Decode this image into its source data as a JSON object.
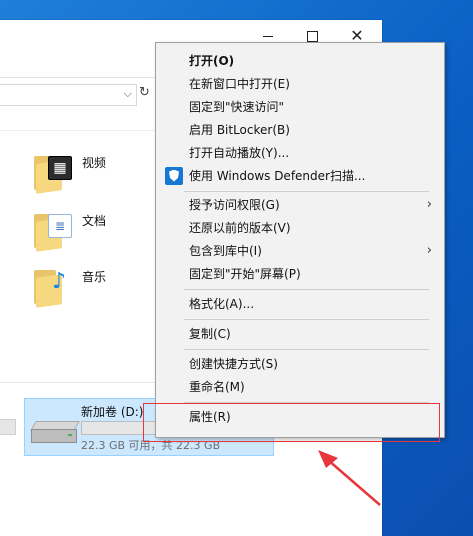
{
  "window": {
    "minimize_glyph": "",
    "close_glyph": "✕"
  },
  "address_bar": {
    "dropdown_glyph": "⌵",
    "refresh_glyph": "↻"
  },
  "folders": [
    {
      "name": "视频",
      "icon": "video-folder-icon",
      "badge": "▦"
    },
    {
      "name": "文档",
      "icon": "documents-folder-icon",
      "badge": "≣"
    },
    {
      "name": "音乐",
      "icon": "music-folder-icon",
      "badge": "♪"
    }
  ],
  "drive": {
    "name": "新加卷 (D:)",
    "space_text": "22.3 GB 可用，共 22.3 GB",
    "used_fraction": 0.0
  },
  "context_menu": {
    "items": [
      {
        "label": "打开(O)",
        "bold": true
      },
      {
        "label": "在新窗口中打开(E)"
      },
      {
        "label": "固定到\"快速访问\""
      },
      {
        "label": "启用 BitLocker(B)"
      },
      {
        "label": "打开自动播放(Y)..."
      },
      {
        "label": "使用 Windows Defender扫描...",
        "icon": "windows-defender-shield-icon"
      },
      {
        "label": "授予访问权限(G)",
        "submenu": true
      },
      {
        "label": "还原以前的版本(V)"
      },
      {
        "label": "包含到库中(I)",
        "submenu": true
      },
      {
        "label": "固定到\"开始\"屏幕(P)"
      },
      {
        "label": "格式化(A)..."
      },
      {
        "label": "复制(C)"
      },
      {
        "label": "创建快捷方式(S)"
      },
      {
        "label": "重命名(M)"
      },
      {
        "label": "属性(R)"
      }
    ],
    "submenu_arrow": "›"
  },
  "colors": {
    "desktop": "#0a5fc4",
    "menu_background": "#f2f2f2",
    "drive_selection": "#cce8ff",
    "annotation_red": "#e8363d"
  }
}
